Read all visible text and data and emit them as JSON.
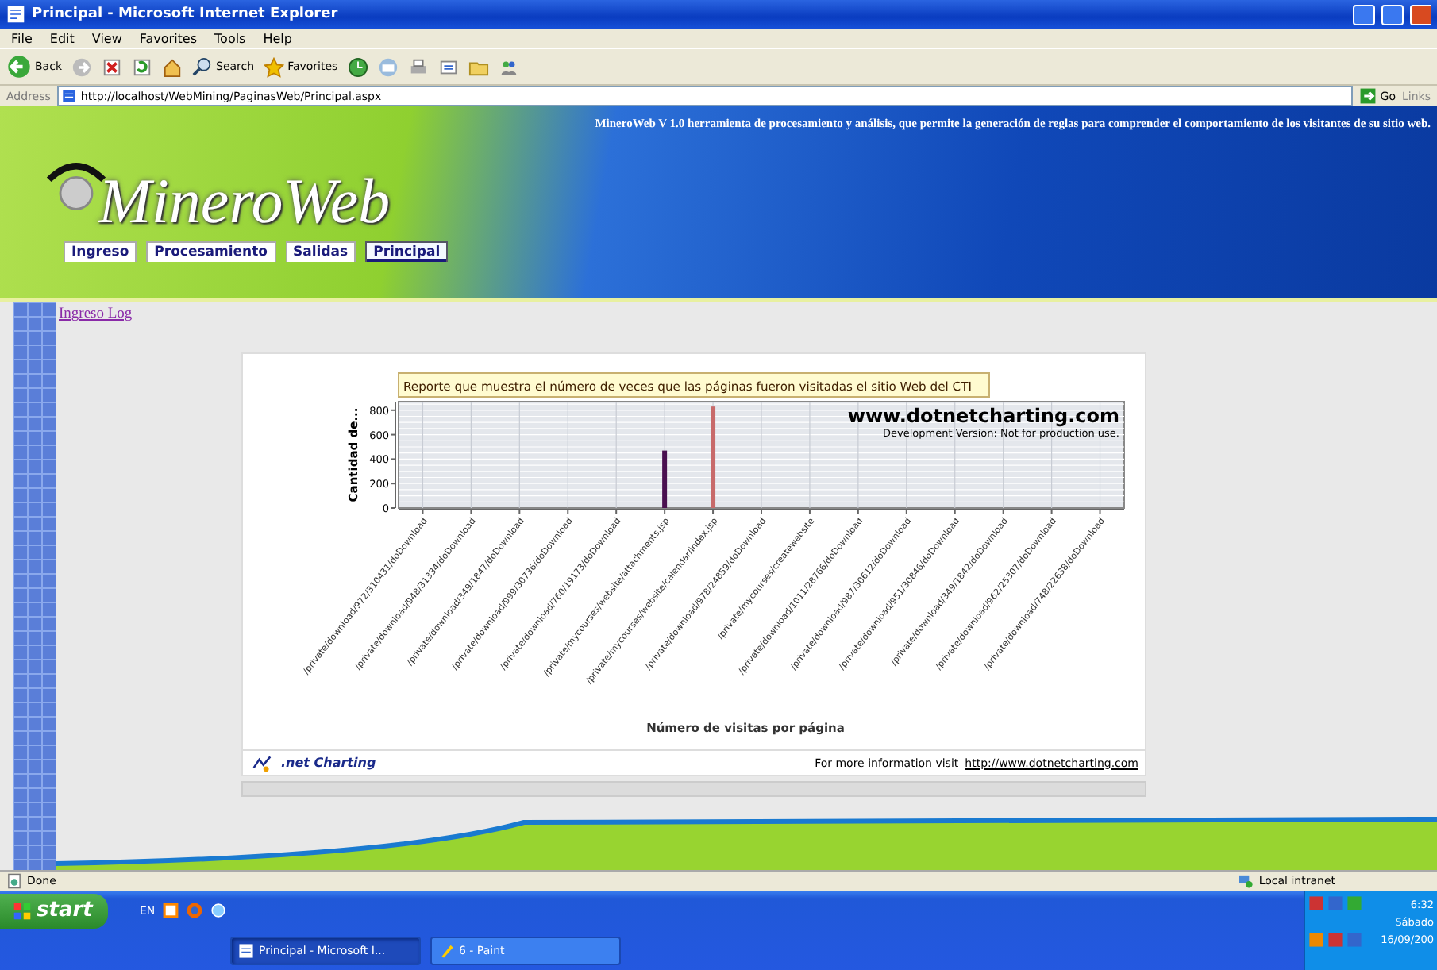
{
  "window": {
    "title": "Principal - Microsoft Internet Explorer"
  },
  "menu": [
    "File",
    "Edit",
    "View",
    "Favorites",
    "Tools",
    "Help"
  ],
  "toolbar": [
    {
      "kind": "back",
      "label": "Back"
    },
    {
      "kind": "forward"
    },
    {
      "kind": "stop"
    },
    {
      "kind": "refresh"
    },
    {
      "kind": "home"
    },
    {
      "kind": "search",
      "label": "Search"
    },
    {
      "kind": "favorites",
      "label": "Favorites"
    },
    {
      "kind": "history"
    },
    {
      "kind": "mail"
    },
    {
      "kind": "print"
    },
    {
      "kind": "edit"
    },
    {
      "kind": "folder"
    },
    {
      "kind": "messenger"
    }
  ],
  "address_bar": {
    "label": "Address",
    "value": "http://localhost/WebMining/PaginasWeb/Principal.aspx",
    "go": "Go",
    "links": "Links"
  },
  "site": {
    "tagline": "MineroWeb V 1.0 herramienta de procesamiento y análisis, que permite la generación de reglas para comprender el comportamiento de los visitantes de su sitio web.",
    "logo": "MineroWeb",
    "tabs": [
      {
        "label": "Ingreso",
        "selected": false
      },
      {
        "label": "Procesamiento",
        "selected": false
      },
      {
        "label": "Salidas",
        "selected": false
      },
      {
        "label": "Principal",
        "selected": true
      }
    ],
    "link": "Ingreso Log"
  },
  "chart": {
    "notice_title": "www.dotnetcharting.com",
    "notice_text": "Development Version: Not for production use.",
    "chart_data": {
      "type": "bar",
      "title": "Reporte que muestra el número de veces que las páginas fueron visitadas el sitio Web del CTI",
      "xlabel": "Número de visitas por página",
      "ylabel": "Cantidad de...",
      "categories": [
        "/private/download/972/310431/doDownload",
        "/private/download/948/31334/doDownload",
        "/private/download/349/1847/doDownload",
        "/private/download/999/30736/doDownload",
        "/private/download/760/19173/doDownload",
        "/private/mycourses/website/attachments.jsp",
        "/private/mycourses/website/calendar/index.jsp",
        "/private/download/978/24859/doDownload",
        "/private/mycourses/createwebsite",
        "/private/download/1011/28766/doDownload",
        "/private/download/987/30612/doDownload",
        "/private/download/951/30846/doDownload",
        "/private/download/349/1842/doDownload",
        "/private/download/962/25307/doDownload",
        "/private/download/748/22638/doDownload"
      ],
      "series": [
        {
          "color": "#4a1050",
          "values": [
            0,
            0,
            0,
            0,
            0,
            470,
            null,
            0,
            0,
            0,
            0,
            0,
            0,
            0,
            0
          ]
        },
        {
          "color": "#c86a6a",
          "values": [
            null,
            null,
            null,
            null,
            null,
            null,
            830,
            null,
            null,
            null,
            null,
            null,
            null,
            null,
            null
          ]
        }
      ],
      "ylim": [
        0,
        870
      ],
      "grid": true,
      "yticks": [
        0,
        200,
        400,
        600,
        800
      ]
    },
    "brand": ".net Charting",
    "footer_text": "For more information visit",
    "footer_link": "http://www.dotnetcharting.com"
  },
  "status_bar": {
    "text": "Done",
    "zone": "Local intranet"
  },
  "taskbar": {
    "start": "start",
    "lang": "EN",
    "tasks": [
      {
        "label": "Principal - Microsoft I...",
        "selected": true
      },
      {
        "label": "6 - Paint",
        "selected": false
      }
    ],
    "time": "6:32",
    "day": "Sábado",
    "date": "16/09/200"
  }
}
